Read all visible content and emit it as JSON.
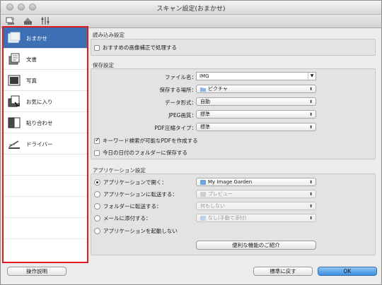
{
  "window": {
    "title": "スキャン設定(おまかせ)"
  },
  "toolbar": {
    "icons": [
      "scan-from-computer-icon",
      "scan-from-operation-panel-icon",
      "general-settings-icon"
    ]
  },
  "sidebar": {
    "items": [
      {
        "label": "おまかせ",
        "icon": "auto-scan-icon",
        "selected": true
      },
      {
        "label": "文書",
        "icon": "document-icon",
        "selected": false
      },
      {
        "label": "写真",
        "icon": "photo-icon",
        "selected": false
      },
      {
        "label": "お気に入り",
        "icon": "favorite-icon",
        "selected": false
      },
      {
        "label": "貼り合わせ",
        "icon": "stitch-icon",
        "selected": false
      },
      {
        "label": "ドライバー",
        "icon": "driver-icon",
        "selected": false
      }
    ]
  },
  "read_settings": {
    "title": "読み込み設定",
    "auto_correct_label": "おすすめの画像補正で処理する",
    "auto_correct_checked": false
  },
  "save_settings": {
    "title": "保存設定",
    "filename_label": "ファイル名：",
    "filename_value": "IMG",
    "location_label": "保存する場所：",
    "location_value": "ピクチャ",
    "format_label": "データ形式：",
    "format_value": "自動",
    "jpeg_label": "JPEG画質：",
    "jpeg_value": "標準",
    "pdf_label": "PDF圧縮タイプ：",
    "pdf_value": "標準",
    "keyword_pdf_label": "キーワード検索が可能なPDFを作成する",
    "keyword_pdf_checked": true,
    "date_folder_label": "今日の日付のフォルダーに保存する",
    "date_folder_checked": false
  },
  "app_settings": {
    "title": "アプリケーション設定",
    "options": [
      {
        "label": "アプリケーションで開く：",
        "value": "My Image Garden",
        "selected": true,
        "enabled": true
      },
      {
        "label": "アプリケーションに転送する：",
        "value": "プレビュー",
        "selected": false,
        "enabled": false
      },
      {
        "label": "フォルダーに転送する：",
        "value": "何もしない",
        "selected": false,
        "enabled": false
      },
      {
        "label": "メールに添付する：",
        "value": "なし(手動で添付)",
        "selected": false,
        "enabled": false
      },
      {
        "label": "アプリケーションを起動しない",
        "value": "",
        "selected": false,
        "enabled": true
      }
    ],
    "more_functions_label": "便利な機能のご紹介"
  },
  "footer": {
    "help_label": "操作説明",
    "defaults_label": "標準に戻す",
    "ok_label": "OK"
  }
}
